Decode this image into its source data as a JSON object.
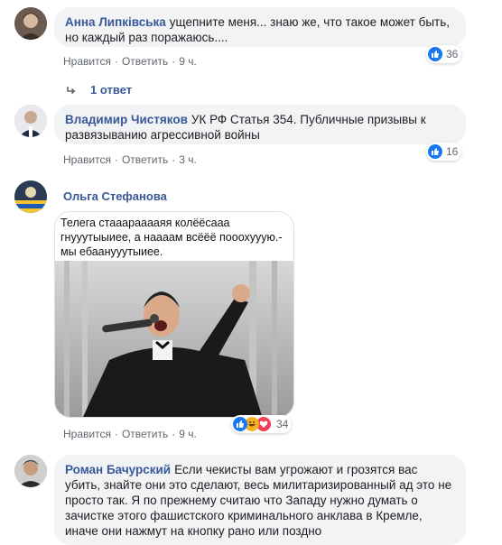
{
  "comments": [
    {
      "author": "Анна Липківська",
      "text": "ущепните меня... знаю же, что такое может быть, но каждый раз поражаюсь....",
      "like": "Нравится",
      "reply": "Ответить",
      "time": "9 ч.",
      "reactions": "36",
      "replies_label": "1 ответ"
    },
    {
      "author": "Владимир Чистяков",
      "text": "УК РФ Статья 354. Публичные призывы к развязыванию агрессивной войны",
      "like": "Нравится",
      "reply": "Ответить",
      "time": "3 ч.",
      "reactions": "16"
    },
    {
      "author": "Ольга Стефанова",
      "meme_caption": "Телега стааарааааяя колёёсааа гнууутыыиее, а наааам всёёё пооохууую.- мы ебаанууутыиее.",
      "like": "Нравится",
      "reply": "Ответить",
      "time": "9 ч.",
      "reactions": "34"
    },
    {
      "author": "Роман Бачурский",
      "text": "Если чекисты вам угрожают и грозятся вас убить, знайте они это сделают, весь милитаризированный ад это не просто так. Я по прежнему считаю что Западу нужно думать о зачистке этого фашистского криминального анклава в Кремле, иначе они нажмут на кнопку рано или поздно"
    }
  ],
  "colors": {
    "link": "#385898",
    "bubble": "#f2f3f5",
    "like_blue": "#1877f2",
    "meta": "#606770"
  },
  "icons": [
    "like-icon",
    "love-icon",
    "haha-icon",
    "reply-arrow-icon"
  ]
}
